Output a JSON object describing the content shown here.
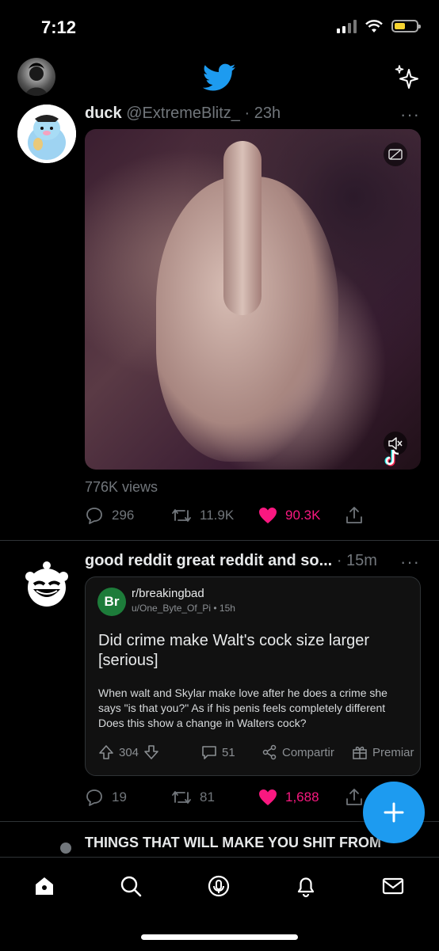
{
  "status_bar": {
    "time": "7:12",
    "battery_level": 0.5,
    "battery_color": "#f7d431"
  },
  "header": {
    "logo_icon": "twitter-bird-icon",
    "sparkle_icon": "sparkle-icon",
    "accent_color": "#1d9bf0"
  },
  "tweet1": {
    "name": "duck",
    "handle": "@ExtremeBlitz_",
    "time": "· 23h",
    "more": "···",
    "views": "776K views",
    "replies": "296",
    "retweets": "11.9K",
    "likes": "90.3K"
  },
  "tweet2": {
    "name": "good reddit great reddit and so...",
    "time": "· 15m",
    "more": "···",
    "card": {
      "subreddit_icon": "Br",
      "subreddit": "r/breakingbad",
      "user_time": "u/One_Byte_Of_Pi • 15h",
      "title": "Did crime make Walt's cock size larger [serious]",
      "body": "When walt and Skylar make love after he does a crime she says \"is that you?\" As if his penis feels completely different Does this show a change in Walters cock?",
      "upvotes": "304",
      "comments": "51",
      "share": "Compartir",
      "award": "Premiar"
    },
    "replies": "19",
    "retweets": "81",
    "likes": "1,688"
  },
  "peek": {
    "text": "THINGS THAT WILL MAKE YOU SHIT FROM"
  },
  "colors": {
    "like": "#f91880",
    "muted": "#71767b"
  }
}
